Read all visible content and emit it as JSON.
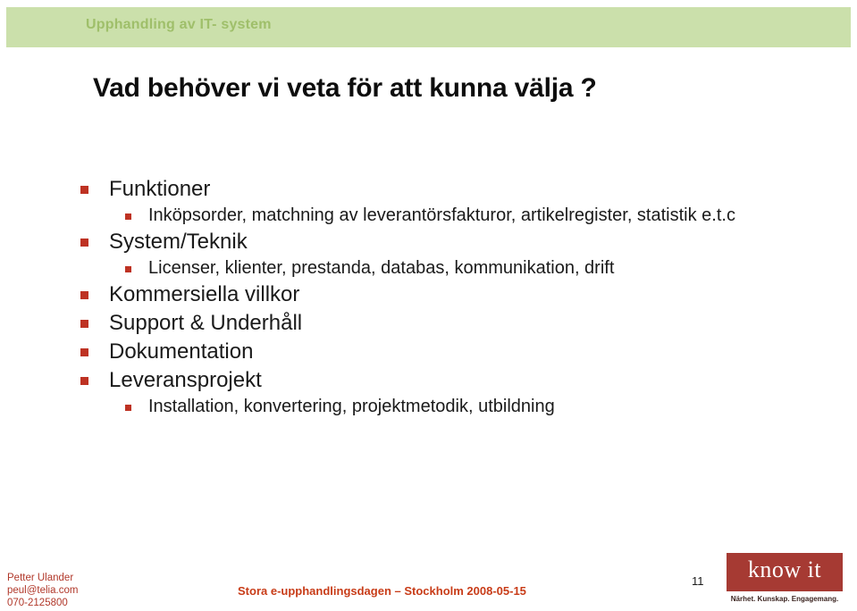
{
  "slide": {
    "header_band_label": "Upphandling av IT- system",
    "title": "Vad behöver vi veta för att kunna välja ?",
    "colors": {
      "header_band_bg": "#cbe0ab",
      "header_band_text": "#9fbf6a",
      "bullet_marker": "#be3223",
      "body_text": "#1a1a1a",
      "footer_contact_text": "#b1382a",
      "footer_event_text": "#c83c18",
      "logo_bg": "#a63a33",
      "logo_text": "#ffffff"
    }
  },
  "bullets": [
    {
      "level": 1,
      "text": "Funktioner"
    },
    {
      "level": 2,
      "text": "Inköpsorder, matchning av leverantörsfakturor, artikelregister, statistik e.t.c"
    },
    {
      "level": 1,
      "text": "System/Teknik"
    },
    {
      "level": 2,
      "text": "Licenser, klienter, prestanda, databas, kommunikation, drift"
    },
    {
      "level": 1,
      "text": "Kommersiella villkor"
    },
    {
      "level": 1,
      "text": "Support & Underhåll"
    },
    {
      "level": 1,
      "text": "Dokumentation"
    },
    {
      "level": 1,
      "text": "Leveransprojekt"
    },
    {
      "level": 2,
      "text": "Installation, konvertering, projektmetodik, utbildning"
    }
  ],
  "footer": {
    "contact_name": "Petter Ulander",
    "contact_email": "peul@telia.com",
    "contact_phone": "070-2125800",
    "event": "Stora e-upphandlingsdagen – Stockholm 2008-05-15",
    "page_number": "11"
  },
  "logo": {
    "wordmark": "know it",
    "tagline": "Närhet. Kunskap. Engagemang."
  }
}
